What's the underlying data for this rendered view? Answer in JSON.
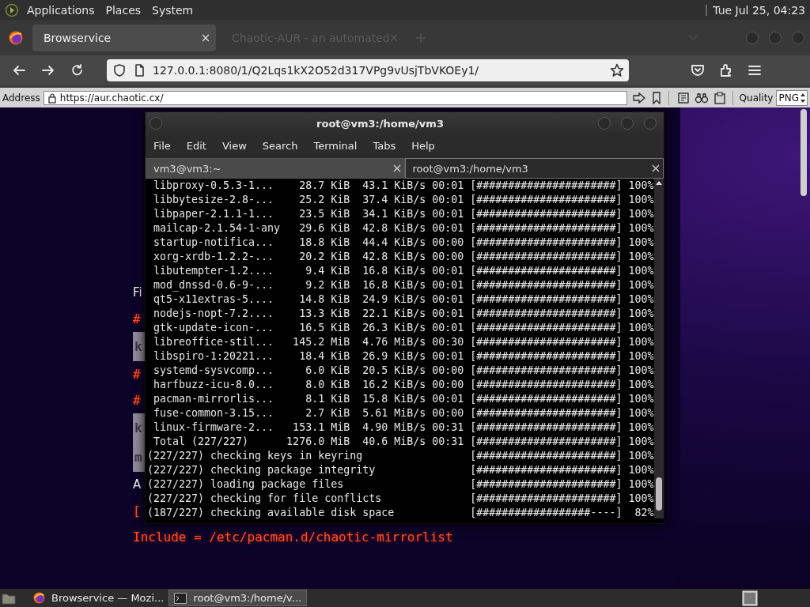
{
  "top_panel": {
    "menus": [
      "Applications",
      "Places",
      "System"
    ],
    "clock": "Tue Jul 25, 04:23"
  },
  "browser": {
    "tabs": [
      {
        "title": "Browservice",
        "selected": true
      },
      {
        "title": "Chaotic-AUR - an automated",
        "selected": false
      }
    ],
    "url": "127.0.0.1:8080/1/Q2Lqs1kX2O52d317VPg9vUsjTbVKOEy1/",
    "toolbar": {
      "address_label": "Address",
      "address": "https://aur.chaotic.cx/",
      "quality_label": "Quality",
      "quality": "PNG"
    }
  },
  "page": {
    "fragments": [
      {
        "kind": "text",
        "text": "Fi"
      },
      {
        "kind": "code",
        "text": "#"
      },
      {
        "kind": "block",
        "lines": [
          "k"
        ]
      },
      {
        "kind": "code",
        "text": "#"
      },
      {
        "kind": "code",
        "text": "#"
      },
      {
        "kind": "block",
        "lines": [
          "k",
          "m"
        ]
      },
      {
        "kind": "text",
        "text": "A"
      },
      {
        "kind": "code",
        "text": "["
      },
      {
        "kind": "code",
        "text": "Include = /etc/pacman.d/chaotic-mirrorlist"
      }
    ]
  },
  "terminal": {
    "title": "root@vm3:/home/vm3",
    "menus": [
      "File",
      "Edit",
      "View",
      "Search",
      "Terminal",
      "Tabs",
      "Help"
    ],
    "tabs": [
      {
        "title": "vm3@vm3:~",
        "selected": false
      },
      {
        "title": "root@vm3:/home/vm3",
        "selected": true
      }
    ],
    "lines": [
      " libproxy-0.5.3-1...    28.7 KiB  43.1 KiB/s 00:01 [######################] 100%",
      " libbytesize-2.8-...    25.2 KiB  37.4 KiB/s 00:01 [######################] 100%",
      " libpaper-2.1.1-1...    23.5 KiB  34.1 KiB/s 00:01 [######################] 100%",
      " mailcap-2.1.54-1-any   29.6 KiB  42.8 KiB/s 00:01 [######################] 100%",
      " startup-notifica...    18.8 KiB  44.4 KiB/s 00:00 [######################] 100%",
      " xorg-xrdb-1.2.2-...    20.2 KiB  42.8 KiB/s 00:00 [######################] 100%",
      " libutempter-1.2....     9.4 KiB  16.8 KiB/s 00:01 [######################] 100%",
      " mod_dnssd-0.6-9-...     9.2 KiB  16.8 KiB/s 00:01 [######################] 100%",
      " qt5-x11extras-5....    14.8 KiB  24.9 KiB/s 00:01 [######################] 100%",
      " nodejs-nopt-7.2....    13.3 KiB  22.1 KiB/s 00:01 [######################] 100%",
      " gtk-update-icon-...    16.5 KiB  26.3 KiB/s 00:01 [######################] 100%",
      " libreoffice-stil...   145.2 MiB  4.76 MiB/s 00:30 [######################] 100%",
      " libspiro-1:20221...    18.4 KiB  26.9 KiB/s 00:01 [######################] 100%",
      " systemd-sysvcomp...     6.0 KiB  20.5 KiB/s 00:00 [######################] 100%",
      " harfbuzz-icu-8.0...     8.0 KiB  16.2 KiB/s 00:00 [######################] 100%",
      " pacman-mirrorlis...     8.1 KiB  15.8 KiB/s 00:01 [######################] 100%",
      " fuse-common-3.15...     2.7 KiB  5.61 MiB/s 00:00 [######################] 100%",
      " linux-firmware-2...   153.1 MiB  4.90 MiB/s 00:31 [######################] 100%",
      " Total (227/227)      1276.0 MiB  40.6 MiB/s 00:31 [######################] 100%",
      "(227/227) checking keys in keyring                 [######################] 100%",
      "(227/227) checking package integrity               [######################] 100%",
      "(227/227) loading package files                    [######################] 100%",
      "(227/227) checking for file conflicts              [######################] 100%",
      "(187/227) checking available disk space            [##################----]  82%"
    ]
  },
  "taskbar": {
    "tasks": [
      {
        "title": "Browservice — Mozi...",
        "kind": "firefox",
        "selected": false
      },
      {
        "title": "root@vm3:/home/v...",
        "kind": "terminal",
        "selected": true
      }
    ]
  }
}
